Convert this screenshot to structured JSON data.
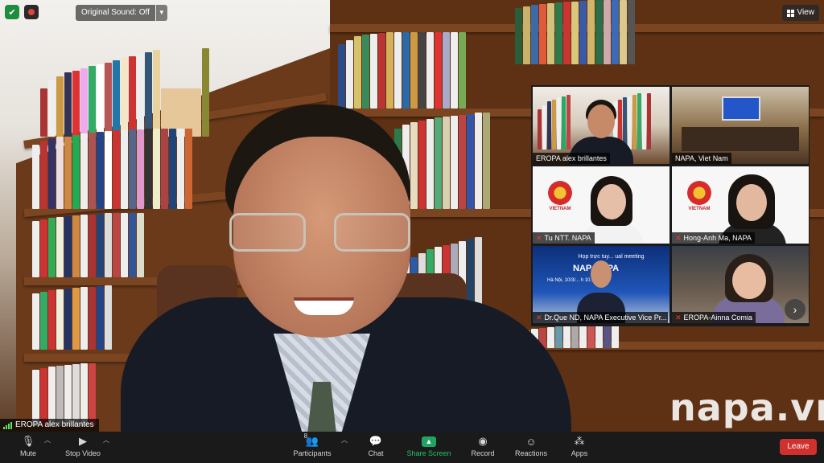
{
  "top": {
    "original_sound": "Original Sound: Off",
    "view_label": "View"
  },
  "main_video": {
    "participant_name": "EROPA alex brillantes",
    "watermark": "napa.vn"
  },
  "gallery": {
    "tiles": [
      {
        "name": "EROPA alex brillantes",
        "muted": false,
        "active": true
      },
      {
        "name": "NAPA, Viet Nam",
        "muted": false,
        "active": false
      },
      {
        "name": "Tu NTT. NAPA",
        "muted": true,
        "active": false,
        "logo_text": "VIETNAM"
      },
      {
        "name": "Hong-Anh Ma, NAPA",
        "muted": true,
        "active": false,
        "logo_text": "VIETNAM"
      },
      {
        "name": "Dr.Que ND, NAPA Executive Vice Pr...",
        "muted": true,
        "active": false,
        "banner_line1": "Họp trực tuy... ual meeting",
        "banner_line2": "NAP... OPA",
        "banner_date": "Hà Nội, 10/3/... h 10, 2022"
      },
      {
        "name": "EROPA-Ainna Comia",
        "muted": true,
        "active": false
      }
    ],
    "next_icon": "chevron-right-icon"
  },
  "toolbar": {
    "mute": "Mute",
    "stop_video": "Stop Video",
    "participants": "Participants",
    "participants_count": "8",
    "chat": "Chat",
    "share_screen": "Share Screen",
    "record": "Record",
    "reactions": "Reactions",
    "apps": "Apps",
    "leave": "Leave"
  },
  "colors": {
    "active_speaker_border": "#d4d12a",
    "share_green": "#22c46a",
    "leave_red": "#d0312d",
    "muted_red": "#e0453a"
  }
}
